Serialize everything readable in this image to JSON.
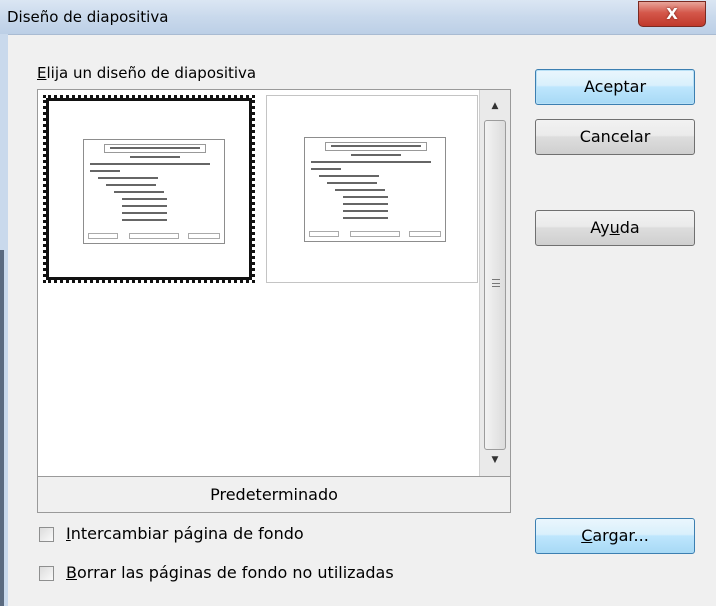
{
  "window": {
    "title": "Diseño de diapositiva",
    "close_label": "X"
  },
  "group": {
    "label_accel": "E",
    "label_rest": "lija un diseño de diapositiva"
  },
  "layouts": {
    "items": [
      {
        "name": "layout-1",
        "selected": true
      },
      {
        "name": "layout-2",
        "selected": false
      }
    ],
    "caption": "Predeterminado"
  },
  "options": {
    "exchange": {
      "accel": "I",
      "rest": "ntercambiar página de fondo",
      "checked": false
    },
    "delete": {
      "accel": "B",
      "rest": "orrar las páginas de fondo no utilizadas",
      "checked": false
    }
  },
  "buttons": {
    "ok": "Aceptar",
    "cancel": "Cancelar",
    "help_pre": "Ay",
    "help_accel": "u",
    "help_post": "da",
    "load_accel": "C",
    "load_rest": "argar..."
  }
}
